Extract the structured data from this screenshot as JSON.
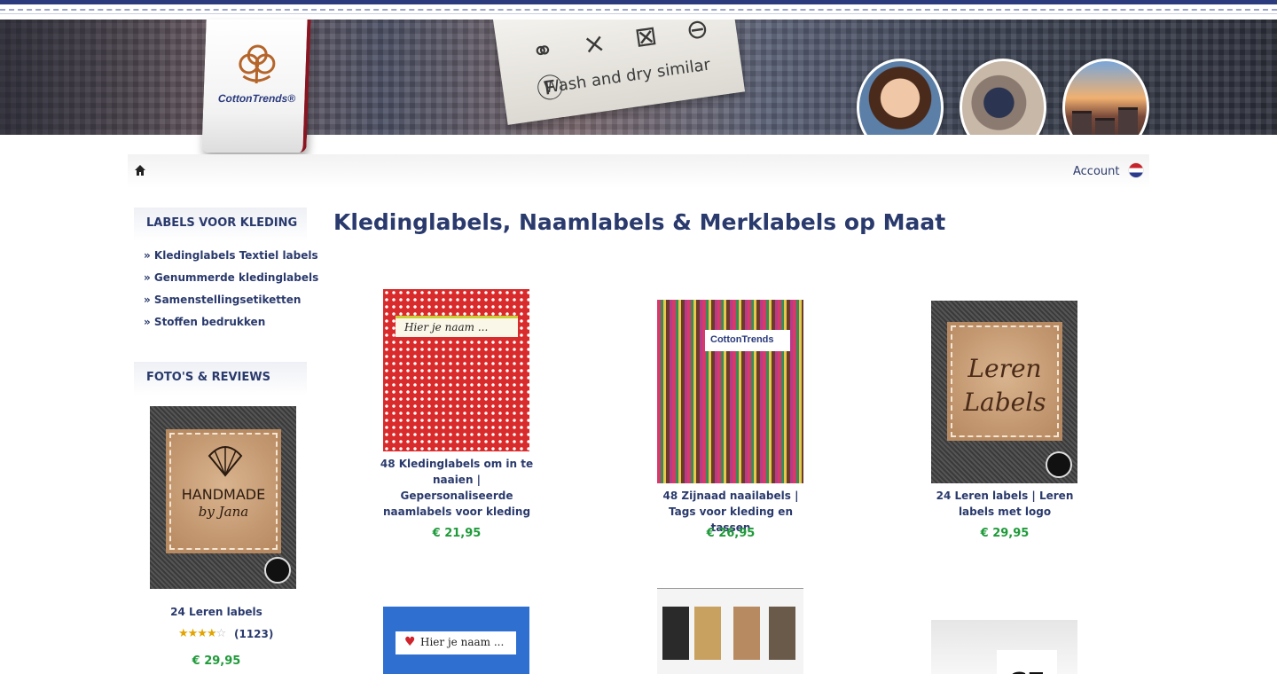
{
  "header": {
    "brand": "CottonTrends®",
    "care_symbols": "⚭ ⨯ ⊠ ⊖ Ⓕ",
    "care_text": "Wash and dry similar"
  },
  "nav": {
    "account_label": "Account"
  },
  "sidebar": {
    "section1_title": "LABELS VOOR KLEDING",
    "links": [
      "» Kledinglabels Textiel labels",
      "» Genummerde kledinglabels",
      "» Samenstellingsetiketten",
      "» Stoffen bedrukken"
    ],
    "section2_title": "FOTO'S & REVIEWS",
    "review": {
      "image_text_1": "HANDMADE",
      "image_text_2": "by Jana",
      "title": "24 Leren labels",
      "rating_stars": 4,
      "count": "(1123)",
      "price": "€ 29,95"
    }
  },
  "main": {
    "title": "Kledinglabels, Naamlabels & Merklabels op Maat",
    "products": [
      {
        "name": "48 Kledinglabels om in te naaien | Gepersonaliseerde naamlabels voor kleding",
        "price": "€ 21,95",
        "image_text": "Hier je naam ..."
      },
      {
        "name": "48 Zijnaad naailabels | Tags voor kleding en tassen",
        "price": "€ 26,95",
        "image_text": "CottonTrends"
      },
      {
        "name": "24 Leren labels | Leren labels met logo",
        "price": "€ 29,95",
        "image_text": "Leren Labels"
      },
      {
        "name": "",
        "price": "",
        "image_text": "Hier je naam ..."
      },
      {
        "name": "",
        "price": "",
        "image_text": ""
      },
      {
        "name": "",
        "price": "",
        "image_text": "CE"
      }
    ]
  },
  "colors": {
    "brand_navy": "#2a3a6d",
    "price_green": "#1f9a3a",
    "accent_red": "#8a1420"
  }
}
